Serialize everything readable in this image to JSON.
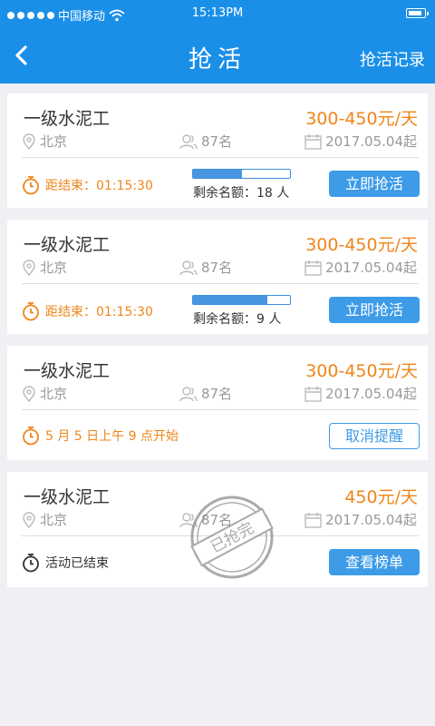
{
  "status_bar": {
    "carrier": "中国移动",
    "time": "15:13PM"
  },
  "nav": {
    "title": "抢活",
    "right_label": "抢活记录"
  },
  "colors": {
    "brand": "#1a8fe8",
    "salary": "#f08519",
    "button": "#3d9be8"
  },
  "cards": [
    {
      "title": "一级水泥工",
      "salary": "300-450元/天",
      "location": "北京",
      "count": "87名",
      "date": "2017.05.04起",
      "countdown": "距结束：01:15:30",
      "progress": 0.5,
      "remaining": "剩余名额：18 人",
      "button": "立即抢活"
    },
    {
      "title": "一级水泥工",
      "salary": "300-450元/天",
      "location": "北京",
      "count": "87名",
      "date": "2017.05.04起",
      "countdown": "距结束：01:15:30",
      "progress": 0.77,
      "remaining": "剩余名额：9 人",
      "button": "立即抢活"
    },
    {
      "title": "一级水泥工",
      "salary": "300-450元/天",
      "location": "北京",
      "count": "87名",
      "date": "2017.05.04起",
      "countdown": "5 月 5 日上午 9 点开始",
      "button": "取消提醒"
    },
    {
      "title": "一级水泥工",
      "salary": "450元/天",
      "location": "北京",
      "count": "87名",
      "date": "2017.05.04起",
      "countdown": "活动已结束",
      "button": "查看榜单",
      "stamp": "已抢完"
    }
  ]
}
